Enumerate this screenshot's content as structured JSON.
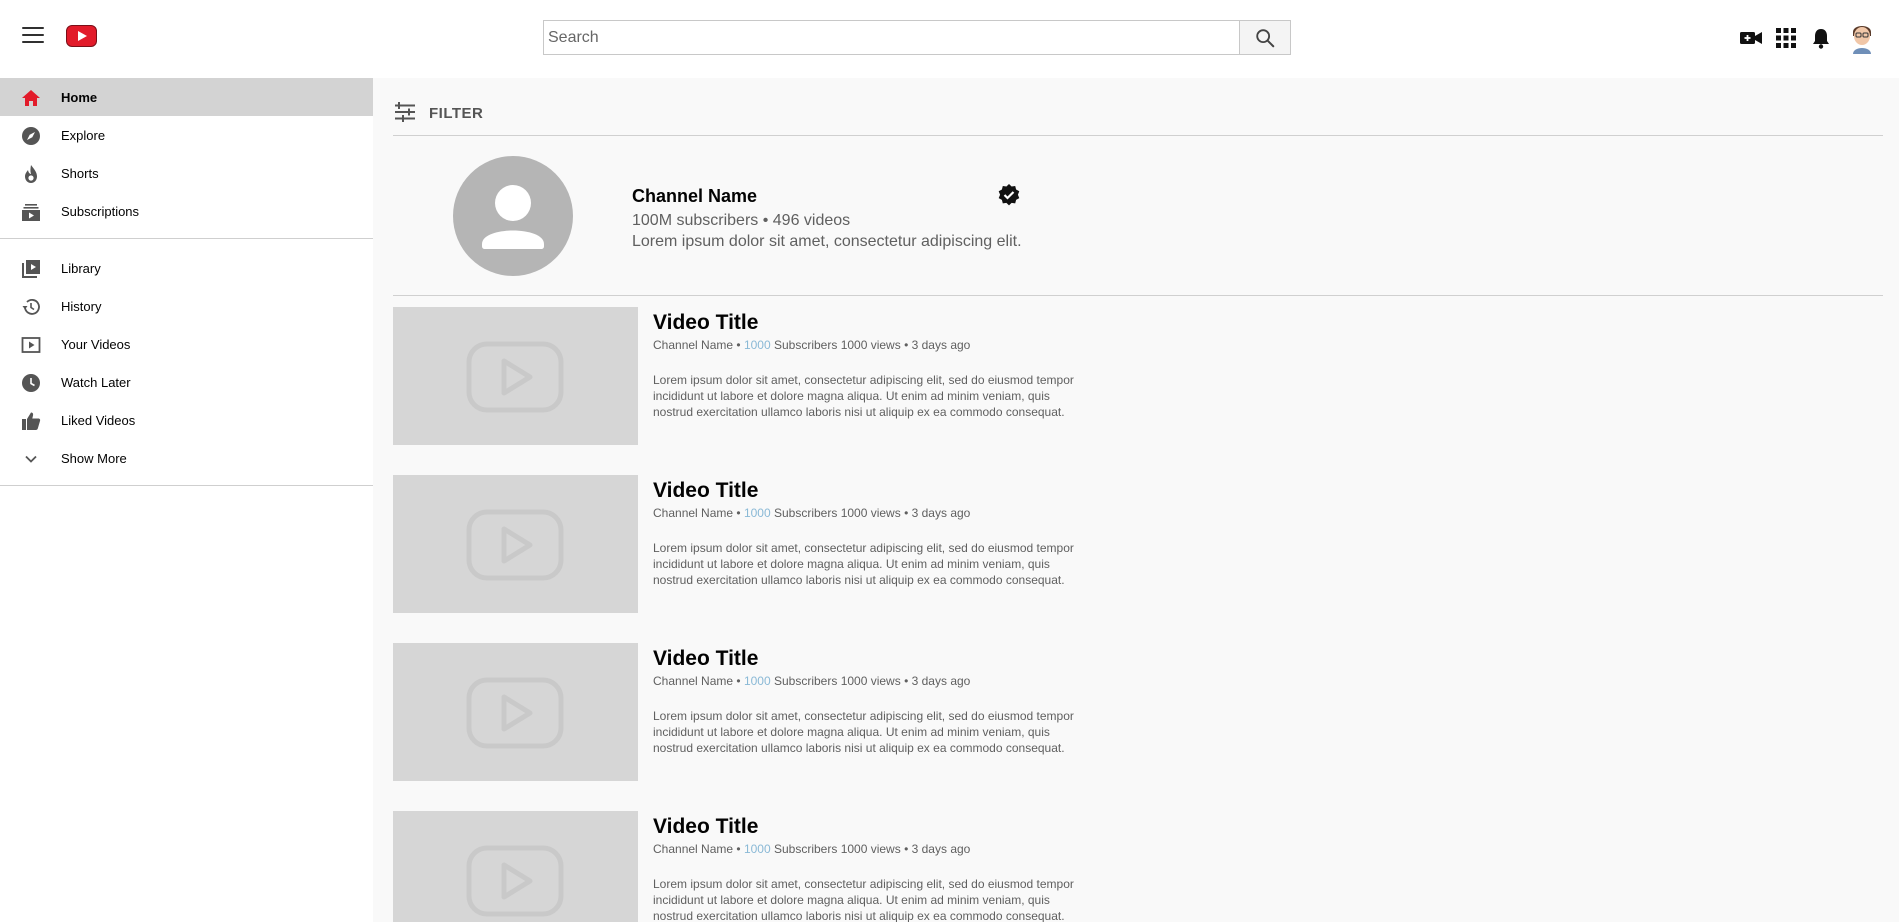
{
  "header": {
    "search_placeholder": "Search"
  },
  "sidebar": {
    "primary": [
      {
        "label": "Home",
        "icon": "home-icon",
        "active": true
      },
      {
        "label": "Explore",
        "icon": "compass-icon"
      },
      {
        "label": "Shorts",
        "icon": "shorts-icon"
      },
      {
        "label": "Subscriptions",
        "icon": "subscriptions-icon"
      }
    ],
    "secondary": [
      {
        "label": "Library",
        "icon": "library-icon"
      },
      {
        "label": "History",
        "icon": "history-icon"
      },
      {
        "label": "Your Videos",
        "icon": "your-videos-icon"
      },
      {
        "label": "Watch Later",
        "icon": "clock-icon"
      },
      {
        "label": "Liked Videos",
        "icon": "thumbs-up-icon"
      },
      {
        "label": "Show More",
        "icon": "chevron-down-icon"
      }
    ]
  },
  "filter": {
    "label": "FILTER"
  },
  "channel": {
    "name": "Channel Name",
    "stats": "100M subscribers • 496 videos",
    "description": "Lorem ipsum dolor sit amet, consectetur adipiscing elit."
  },
  "videos": [
    {
      "title": "Video Title",
      "channel": "Channel Name",
      "sep1": "•",
      "subscriber_count": "1000",
      "subscribers_label": "Subscribers",
      "views": "1000 views",
      "sep2": "•",
      "age": "3 days ago",
      "description": "Lorem ipsum dolor sit amet, consectetur adipiscing elit, sed do eiusmod tempor incididunt ut labore et dolore magna aliqua. Ut enim ad minim veniam, quis nostrud exercitation ullamco laboris nisi ut aliquip ex ea commodo consequat."
    },
    {
      "title": "Video Title",
      "channel": "Channel Name",
      "sep1": "•",
      "subscriber_count": "1000",
      "subscribers_label": "Subscribers",
      "views": "1000 views",
      "sep2": "•",
      "age": "3 days ago",
      "description": "Lorem ipsum dolor sit amet, consectetur adipiscing elit, sed do eiusmod tempor incididunt ut labore et dolore magna aliqua. Ut enim ad minim veniam, quis nostrud exercitation ullamco laboris nisi ut aliquip ex ea commodo consequat."
    },
    {
      "title": "Video Title",
      "channel": "Channel Name",
      "sep1": "•",
      "subscriber_count": "1000",
      "subscribers_label": "Subscribers",
      "views": "1000 views",
      "sep2": "•",
      "age": "3 days ago",
      "description": "Lorem ipsum dolor sit amet, consectetur adipiscing elit, sed do eiusmod tempor incididunt ut labore et dolore magna aliqua. Ut enim ad minim veniam, quis nostrud exercitation ullamco laboris nisi ut aliquip ex ea commodo consequat."
    },
    {
      "title": "Video Title",
      "channel": "Channel Name",
      "sep1": "•",
      "subscriber_count": "1000",
      "subscribers_label": "Subscribers",
      "views": "1000 views",
      "sep2": "•",
      "age": "3 days ago",
      "description": "Lorem ipsum dolor sit amet, consectetur adipiscing elit, sed do eiusmod tempor incididunt ut labore et dolore magna aliqua. Ut enim ad minim veniam, quis nostrud exercitation ullamco laboris nisi ut aliquip ex ea commodo consequat."
    }
  ],
  "colors": {
    "brand_red": "#e21b2a",
    "active_bg": "#d3d3d3",
    "subscriber_highlight": "#8ab9d6",
    "thumbnail_bg": "#d6d6d6"
  }
}
